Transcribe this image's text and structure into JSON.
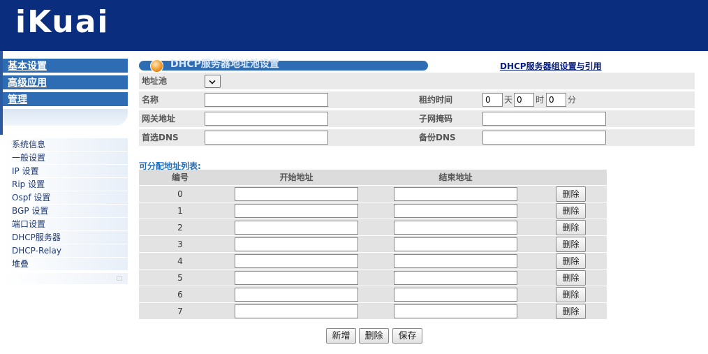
{
  "header": {
    "logo_text": "iKuai",
    "bg_color": "#0a2d7e"
  },
  "sidebar": {
    "top_menus": [
      "基本设置",
      "高级应用",
      "管理"
    ],
    "items": [
      "系统信息",
      "一般设置",
      "IP 设置",
      "Rip 设置",
      "Ospf 设置",
      "BGP 设置",
      "端口设置",
      "DHCP服务器",
      "DHCP-Relay",
      "堆叠"
    ]
  },
  "page": {
    "title": "DHCP服务器地址池设置",
    "group_link": "DHCP服务器组设置与引用"
  },
  "form": {
    "pool_label": "地址池",
    "pool_value": "",
    "name_label": "名称",
    "name_value": "",
    "lease_label": "租约时间",
    "lease_days": "0",
    "lease_days_unit": "天",
    "lease_hours": "0",
    "lease_hours_unit": "时",
    "lease_minutes": "0",
    "lease_minutes_unit": "分",
    "gateway_label": "网关地址",
    "gateway_value": "",
    "subnet_label": "子网掩码",
    "subnet_value": "",
    "dns1_label": "首选DNS",
    "dns1_value": "",
    "dns2_label": "备份DNS",
    "dns2_value": ""
  },
  "list": {
    "title": "可分配地址列表:",
    "headers": [
      "编号",
      "开始地址",
      "结束地址"
    ],
    "delete_label": "删除",
    "rows": [
      {
        "num": "0",
        "start": "",
        "end": ""
      },
      {
        "num": "1",
        "start": "",
        "end": ""
      },
      {
        "num": "2",
        "start": "",
        "end": ""
      },
      {
        "num": "3",
        "start": "",
        "end": ""
      },
      {
        "num": "4",
        "start": "",
        "end": ""
      },
      {
        "num": "5",
        "start": "",
        "end": ""
      },
      {
        "num": "6",
        "start": "",
        "end": ""
      },
      {
        "num": "7",
        "start": "",
        "end": ""
      }
    ]
  },
  "actions": {
    "add_label": "新增",
    "delete_label": "删除",
    "save_label": "保存"
  }
}
